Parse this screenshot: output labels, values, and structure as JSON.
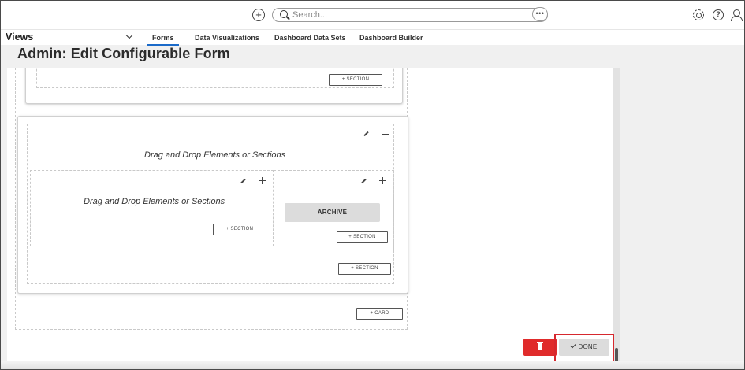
{
  "topbar": {
    "search_placeholder": "Search...",
    "more_label": "•••",
    "add_symbol": "+"
  },
  "nav": {
    "views_label": "Views",
    "tabs": [
      {
        "label": "Forms",
        "active": true
      },
      {
        "label": "Data Visualizations",
        "active": false
      },
      {
        "label": "Dashboard Data Sets",
        "active": false
      },
      {
        "label": "Dashboard Builder",
        "active": false
      }
    ]
  },
  "page": {
    "title": "Admin: Edit Configurable Form"
  },
  "form": {
    "section_button_label": "+  SECTION",
    "card_button_label": "+  CARD",
    "drop_hint": "Drag and Drop Elements or Sections",
    "archive_label": "ARCHIVE"
  },
  "actions": {
    "done_label": "DONE"
  },
  "colors": {
    "accent": "#1a6ac9",
    "delete": "#e02b2b",
    "highlight": "#d6282e"
  }
}
